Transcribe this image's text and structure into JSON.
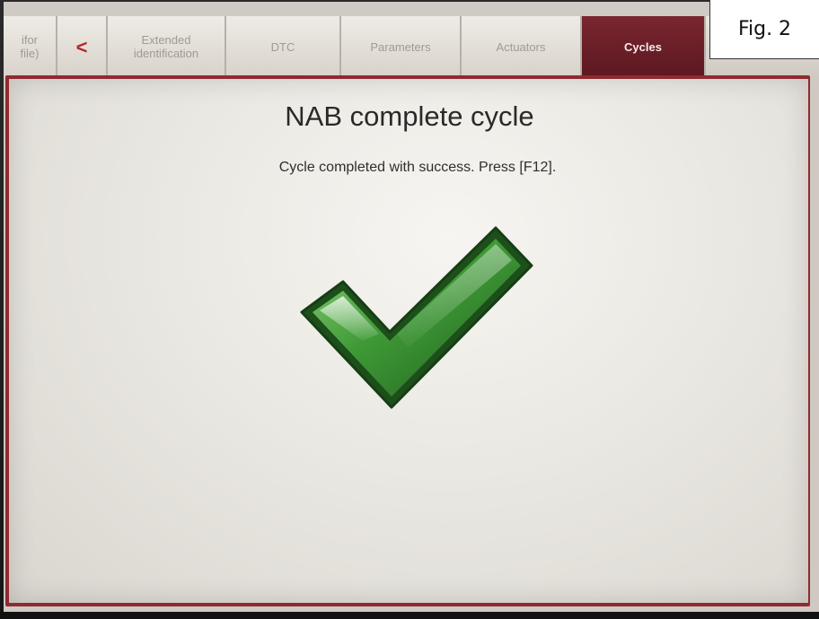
{
  "tabs": [
    {
      "label": "ifor\nfile)",
      "active": false
    },
    {
      "label": "<",
      "active": false,
      "kind": "back",
      "icon": "chevron-left-icon"
    },
    {
      "label": "Extended\nidentification",
      "active": false
    },
    {
      "label": "DTC",
      "active": false
    },
    {
      "label": "Parameters",
      "active": false
    },
    {
      "label": "Actuators",
      "active": false
    },
    {
      "label": "Cycles",
      "active": true
    }
  ],
  "dialog": {
    "title": "NAB complete cycle",
    "message": "Cycle completed with success. Press [F12].",
    "status_icon": "checkmark-icon"
  },
  "figure_label": "Fig. 2",
  "colors": {
    "active_tab": "#6a1e28",
    "frame": "#8e2a31",
    "check_green": "#3f9a36"
  }
}
